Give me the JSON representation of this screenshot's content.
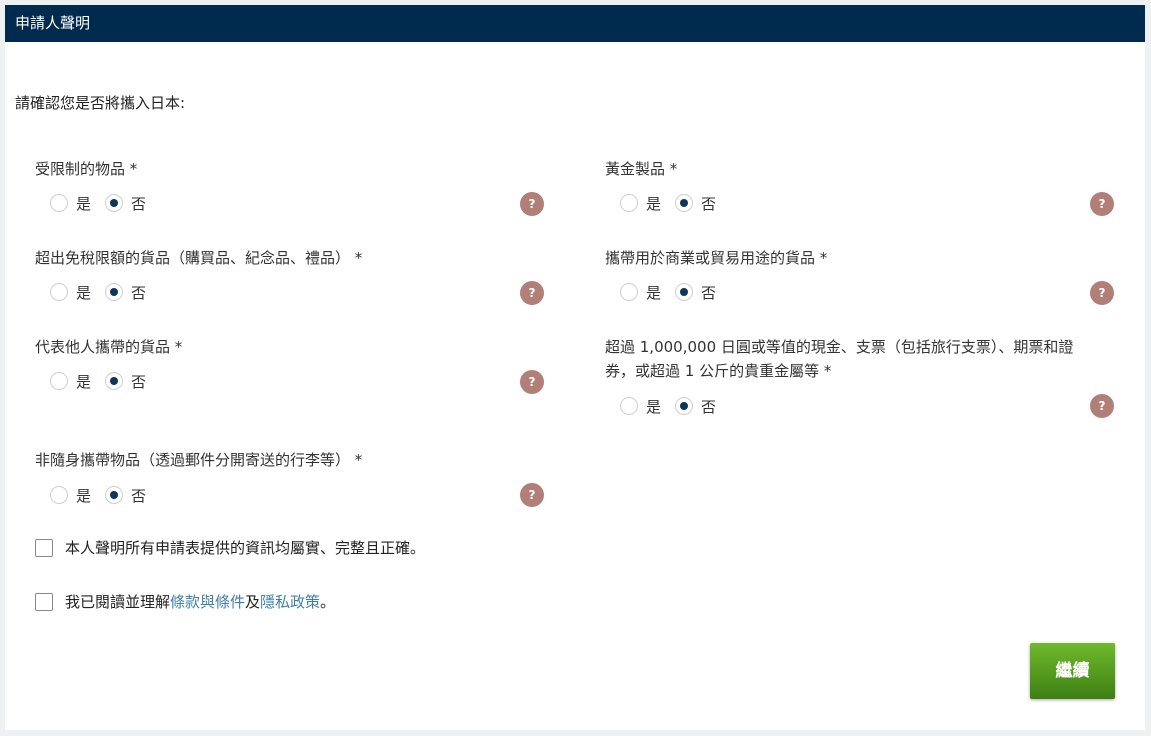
{
  "header": {
    "title": "申請人聲明"
  },
  "intro": "請確認您是否將攜入日本:",
  "radio_yes": "是",
  "radio_no": "否",
  "help_glyph": "?",
  "questions": [
    {
      "label": "受限制的物品 *",
      "selected": "no"
    },
    {
      "label": "黃金製品 *",
      "selected": "no"
    },
    {
      "label": "超出免稅限額的貨品（購買品、紀念品、禮品） *",
      "selected": "no"
    },
    {
      "label": "攜帶用於商業或貿易用途的貨品 *",
      "selected": "no"
    },
    {
      "label": "代表他人攜帶的貨品 *",
      "selected": "no"
    },
    {
      "label_line1": "超過 1,000,000 日圓或等值的現金、支票（包括旅行支票）、期票和證",
      "label_line2": "券，或超過 1 公斤的貴重金屬等 *",
      "selected": "no"
    },
    {
      "label": "非隨身攜帶物品（透過郵件分開寄送的行李等） *",
      "selected": "no"
    }
  ],
  "declaration_1": "本人聲明所有申請表提供的資訊均屬實、完整且正確。",
  "declaration_2": {
    "prefix": "我已閱讀並理解",
    "terms_link": "條款與條件",
    "joiner": "及",
    "privacy_link": "隱私政策",
    "suffix": "。"
  },
  "continue_button": "繼續"
}
